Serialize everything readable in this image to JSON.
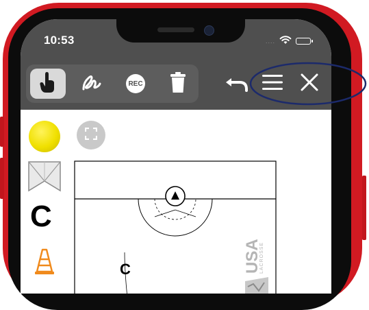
{
  "status_bar": {
    "time": "10:53",
    "signal_icon": "cellular-dots-icon",
    "wifi_icon": "wifi-icon",
    "battery_icon": "battery-full-icon",
    "signal_dots": "...."
  },
  "toolbar": {
    "tools": [
      {
        "name": "touch-tool",
        "icon": "hand-pointer-icon",
        "active": true
      },
      {
        "name": "draw-tool",
        "icon": "squiggle-pen-icon",
        "active": false
      },
      {
        "name": "record-tool",
        "icon": "rec-icon",
        "label": "REC",
        "active": false
      },
      {
        "name": "delete-tool",
        "icon": "trash-icon",
        "active": false
      }
    ],
    "undo_icon": "undo-icon",
    "menu_icon": "hamburger-menu-icon",
    "close_icon": "close-x-icon",
    "highlight_color": "#1c2a6b"
  },
  "palette": {
    "ball_color": "#f0e000",
    "fullscreen_icon": "expand-corners-icon",
    "goal_icon": "goal-net-icon",
    "coach_label": "C",
    "cone_icon": "cone-icon",
    "cone_color": "#f08a1c"
  },
  "field": {
    "player_label": "C",
    "watermark": "USA",
    "watermark_sub": "LACROSSE"
  },
  "colors": {
    "phone_red": "#d11a22",
    "toolbar_bg": "#4f4f4f"
  }
}
